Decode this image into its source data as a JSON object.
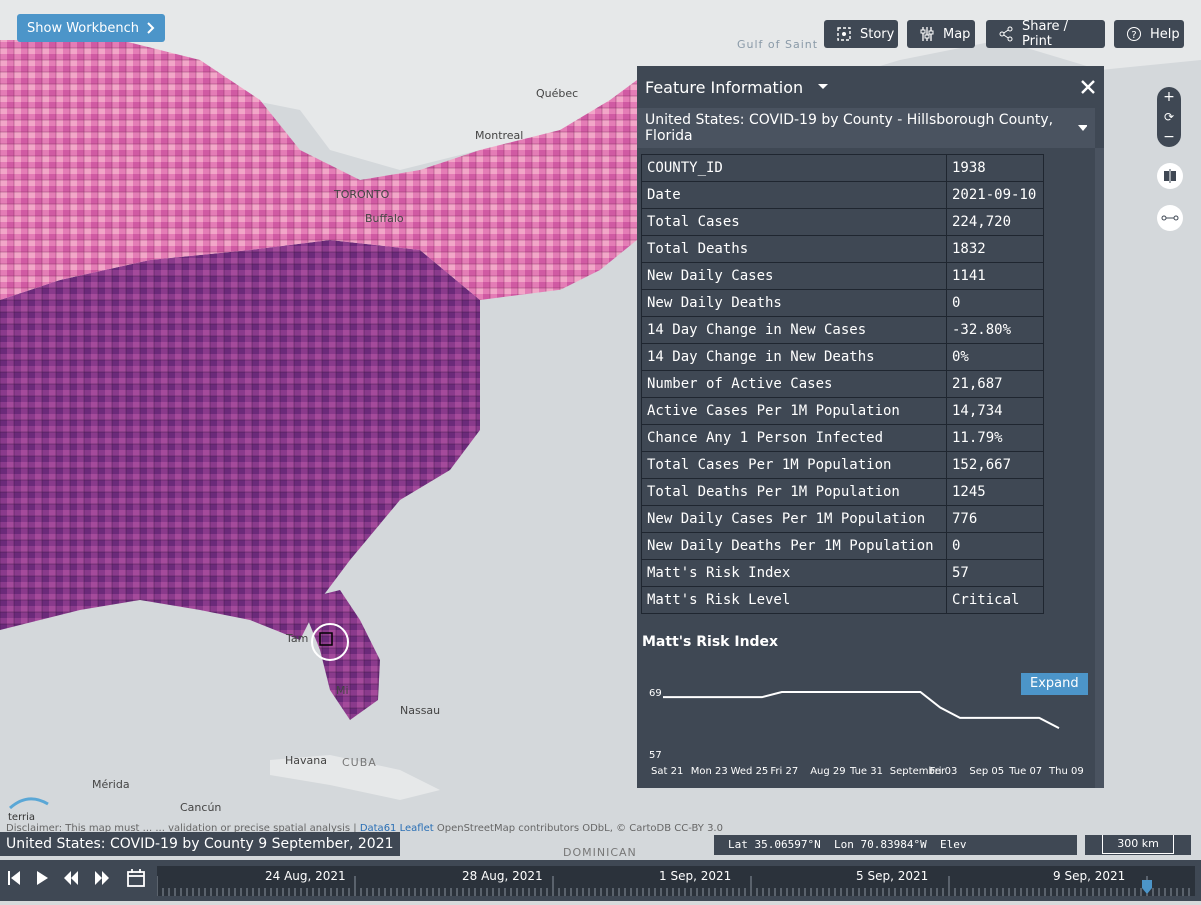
{
  "map": {
    "labels": {
      "gulf": "Gulf of Saint",
      "quebec": "Québec",
      "montreal": "Montreal",
      "toronto": "TORONTO",
      "buffalo": "Buffalo",
      "tampa": "Tam",
      "nassau": "Nassau",
      "havana": "Havana",
      "cuba": "CUBA",
      "cancun": "Cancún",
      "merida": "Mérida",
      "dominican": "DOMINICAN",
      "mi": "Mi"
    }
  },
  "toolbar": {
    "workbench": "Show Workbench",
    "story": "Story",
    "map": "Map",
    "share": "Share / Print",
    "help": "Help"
  },
  "panel": {
    "title": "Feature Information",
    "subtitle": "United States: COVID-19 by County - Hillsborough County, Florida",
    "rows": [
      {
        "key": "COUNTY_ID",
        "value": "1938"
      },
      {
        "key": "Date",
        "value": "2021-09-10"
      },
      {
        "key": "Total Cases",
        "value": "224,720"
      },
      {
        "key": "Total Deaths",
        "value": "1832"
      },
      {
        "key": "New Daily Cases",
        "value": "1141"
      },
      {
        "key": "New Daily Deaths",
        "value": "0"
      },
      {
        "key": "14 Day Change in New Cases",
        "value": "-32.80%"
      },
      {
        "key": "14 Day Change in New Deaths",
        "value": "0%"
      },
      {
        "key": "Number of Active Cases",
        "value": "21,687"
      },
      {
        "key": "Active Cases Per 1M Population",
        "value": "14,734"
      },
      {
        "key": "Chance Any 1 Person Infected",
        "value": "11.79%"
      },
      {
        "key": "Total Cases Per 1M Population",
        "value": "152,667"
      },
      {
        "key": "Total Deaths Per 1M Population",
        "value": "1245"
      },
      {
        "key": "New Daily Cases Per 1M Population",
        "value": "776"
      },
      {
        "key": "New Daily Deaths Per 1M Population",
        "value": "0"
      },
      {
        "key": "Matt's Risk Index",
        "value": "57"
      },
      {
        "key": "Matt's Risk Level",
        "value": "Critical"
      }
    ],
    "chart_title": "Matt's Risk Index",
    "expand": "Expand"
  },
  "chart_data": {
    "type": "line",
    "title": "Matt's Risk Index",
    "y_ticks": [
      "69",
      "57"
    ],
    "ylim": [
      57,
      69
    ],
    "x_ticks": [
      "Sat 21",
      "Mon 23",
      "Wed 25",
      "Fri 27",
      "Aug 29",
      "Tue 31",
      "September",
      "Fri 03",
      "Sep 05",
      "Tue 07",
      "Thu 09"
    ],
    "x": [
      "2021-08-21",
      "2021-08-22",
      "2021-08-23",
      "2021-08-24",
      "2021-08-25",
      "2021-08-26",
      "2021-08-27",
      "2021-08-28",
      "2021-08-29",
      "2021-08-30",
      "2021-08-31",
      "2021-09-01",
      "2021-09-02",
      "2021-09-03",
      "2021-09-04",
      "2021-09-05",
      "2021-09-06",
      "2021-09-07",
      "2021-09-08",
      "2021-09-09",
      "2021-09-10"
    ],
    "values": [
      68,
      68,
      68,
      68,
      68,
      68,
      69,
      69,
      69,
      69,
      69,
      69,
      69,
      69,
      66,
      64,
      64,
      64,
      64,
      64,
      62
    ],
    "line_color": "#ffffff"
  },
  "status": {
    "caption": "United States: COVID-19 by County 9 September, 2021",
    "lat_label": "Lat",
    "lat": "35.06597°N",
    "lon_label": "Lon",
    "lon": "70.83984°W",
    "elev_label": "Elev",
    "scale": "300 km",
    "attribution_pre": "Disclaimer: This map must ...",
    "attribution_mid": "... validation or precise spatial analysis |",
    "data61": "Data61",
    "leaflet": "Leaflet",
    "attribution_post": "OpenStreetMap contributors ODbL, © CartoDB CC-BY 3.0",
    "logo": "terria"
  },
  "timeline": {
    "labels": [
      "24 Aug, 2021",
      "28 Aug, 2021",
      "1 Sep, 2021",
      "5 Sep, 2021",
      "9 Sep, 2021"
    ]
  },
  "colors": {
    "panel": "#3f4854",
    "accent": "#4c95c9",
    "county_dark": "#5a1f6d",
    "county_light": "#f2a6c8"
  }
}
